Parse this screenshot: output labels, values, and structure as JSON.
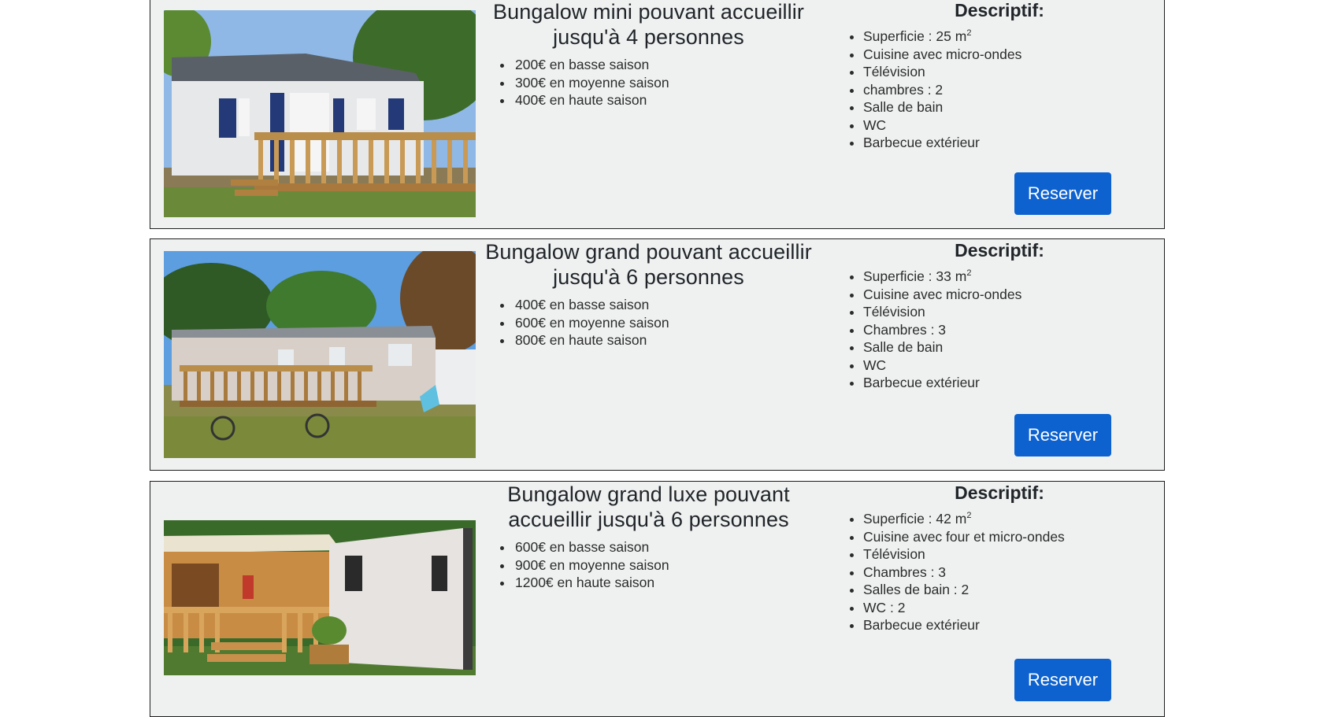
{
  "offers": [
    {
      "title": "Bungalow mini pouvant accueillir jusqu'à 4 personnes",
      "image": "bungalow-mini-photo",
      "prices": [
        "200€ en basse saison",
        "300€ en moyenne saison",
        "400€ en haute saison"
      ],
      "descriptif_label": "Descriptif:",
      "surface": "Superficie : 25 m",
      "surface_unit_sup": "2",
      "features": [
        "Cuisine avec micro-ondes",
        "Télévision",
        "chambres : 2",
        "Salle de bain",
        "WC",
        "Barbecue extérieur"
      ],
      "button_label": "Reserver"
    },
    {
      "title": "Bungalow grand pouvant accueillir jusqu'à 6 personnes",
      "image": "bungalow-grand-photo",
      "prices": [
        "400€ en basse saison",
        "600€ en moyenne saison",
        "800€ en haute saison"
      ],
      "descriptif_label": "Descriptif:",
      "surface": "Superficie : 33 m",
      "surface_unit_sup": "2",
      "features": [
        "Cuisine avec micro-ondes",
        "Télévision",
        "Chambres : 3",
        "Salle de bain",
        "WC",
        "Barbecue extérieur"
      ],
      "button_label": "Reserver"
    },
    {
      "title": "Bungalow grand luxe pouvant accueillir jusqu'à 6 personnes",
      "image": "bungalow-luxe-photo",
      "prices": [
        "600€ en basse saison",
        "900€ en moyenne saison",
        "1200€ en haute saison"
      ],
      "descriptif_label": "Descriptif:",
      "surface": "Superficie : 42 m",
      "surface_unit_sup": "2",
      "features": [
        "Cuisine avec four et micro-ondes",
        "Télévision",
        "Chambres : 3",
        "Salles de bain : 2",
        "WC : 2",
        "Barbecue extérieur"
      ],
      "button_label": "Reserver"
    }
  ],
  "colors": {
    "card_background": "#eff1f1",
    "card_border": "#1e1e1e",
    "button_background": "#0d62d0",
    "button_text": "#ffffff"
  }
}
